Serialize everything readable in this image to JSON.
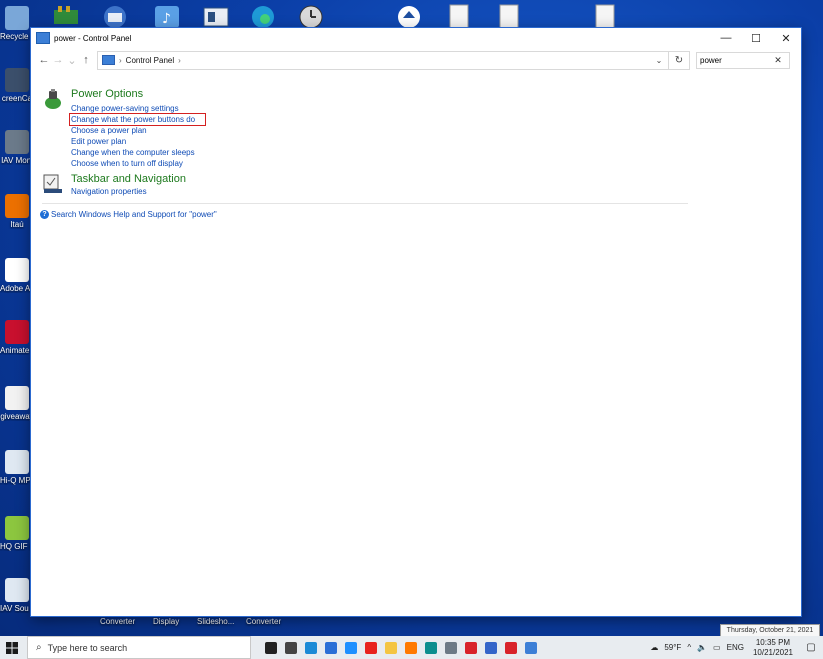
{
  "desktop": {
    "icons": [
      {
        "label": "Recycle B",
        "name": "recycle-bin-icon",
        "color": "#7aa7d8"
      },
      {
        "label": "creenCa",
        "name": "screen-capture-icon",
        "color": "#3b4f6b"
      },
      {
        "label": "IAV Moni",
        "name": "monitor-app-icon",
        "color": "#6b7a8a"
      },
      {
        "label": "Itaú",
        "name": "itau-icon",
        "color": "#ec7000"
      },
      {
        "label": "Adobe Acrobat",
        "name": "acrobat-icon",
        "color": "#ffffff"
      },
      {
        "label": "Animate Banner",
        "name": "animate-icon",
        "color": "#c8102e"
      },
      {
        "label": "giveaway",
        "name": "document-icon",
        "color": "#f2f2f2"
      },
      {
        "label": "Hi-Q MP Recorder",
        "name": "music-file-icon",
        "color": "#dfe8f2"
      },
      {
        "label": "HQ GIF Maker",
        "name": "gif-maker-icon",
        "color": "#8cc63f"
      },
      {
        "label": "IAV Sou Recorder",
        "name": "sound-recorder-icon",
        "color": "#dfe8f2"
      }
    ],
    "bottom_labels": [
      "Converter",
      "Display",
      "Slidesho...",
      "Converter"
    ]
  },
  "window": {
    "title": "power - Control Panel",
    "minimize": "—",
    "maximize": "☐",
    "close": "✕"
  },
  "nav": {
    "back": "←",
    "forward": "→",
    "recent": "⌄",
    "up": "↑"
  },
  "address": {
    "crumb": "Control Panel",
    "sep1": "›",
    "sep2": "›",
    "dropdown": "⌄",
    "refresh": "↻"
  },
  "search": {
    "value": "power",
    "clear": "✕"
  },
  "results": {
    "power": {
      "heading": "Power Options",
      "links": [
        "Change power-saving settings",
        "Change what the power buttons do",
        "Choose a power plan",
        "Edit power plan",
        "Change when the computer sleeps",
        "Choose when to turn off display"
      ]
    },
    "taskbar_nav": {
      "heading": "Taskbar and Navigation",
      "links": [
        "Navigation properties"
      ]
    },
    "help": "Search Windows Help and Support for \"power\""
  },
  "taskbar": {
    "search_placeholder": "Type here to search",
    "weather": "59°F",
    "lang": "ENG",
    "time": "10:35 PM",
    "date": "10/21/2021",
    "date_tooltip": "Thursday, October 21, 2021",
    "apps": [
      {
        "name": "cortana-icon",
        "color": "#222222"
      },
      {
        "name": "task-view-icon",
        "color": "#444444"
      },
      {
        "name": "edge-icon",
        "color": "#1b8ad6"
      },
      {
        "name": "store-icon",
        "color": "#2a6fd6"
      },
      {
        "name": "ie-icon",
        "color": "#1e90ff"
      },
      {
        "name": "opera-icon",
        "color": "#e8231e"
      },
      {
        "name": "file-explorer-icon",
        "color": "#f4c542"
      },
      {
        "name": "firefox-icon",
        "color": "#ff7a00"
      },
      {
        "name": "app-teal-icon",
        "color": "#0c8e8e"
      },
      {
        "name": "app-grey-icon",
        "color": "#6d7a86"
      },
      {
        "name": "app-red-icon",
        "color": "#d8232a"
      },
      {
        "name": "app-blue-icon",
        "color": "#3465c9"
      },
      {
        "name": "app-red2-icon",
        "color": "#d8232a"
      },
      {
        "name": "control-panel-taskbar-icon",
        "color": "#3c7fd6"
      }
    ]
  }
}
